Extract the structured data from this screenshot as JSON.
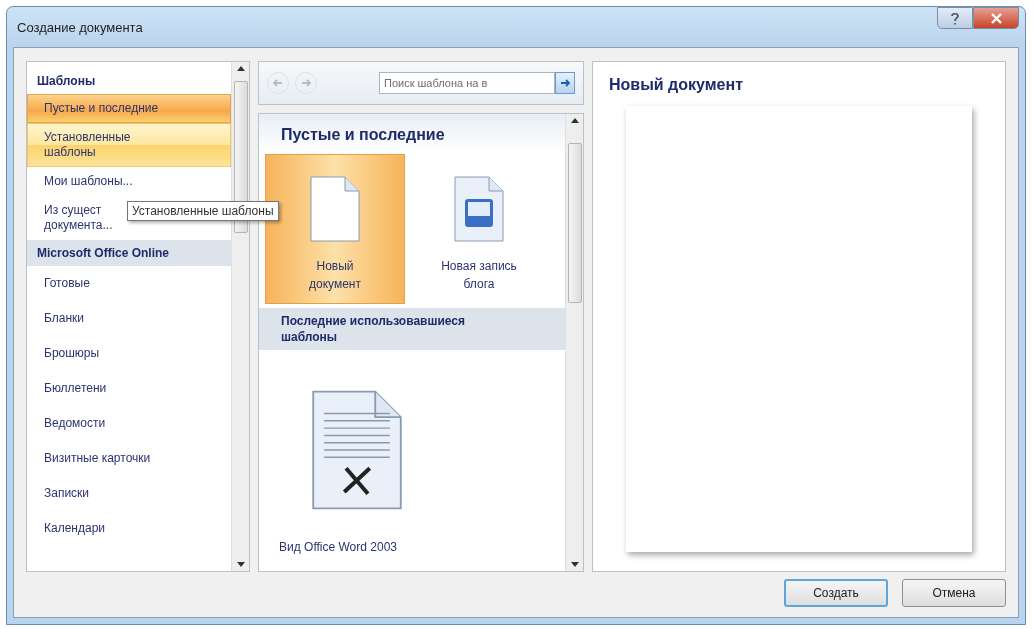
{
  "window": {
    "title": "Создание документа"
  },
  "sidebar": {
    "sections": [
      {
        "title": "Шаблоны",
        "kind": "plain",
        "items": [
          {
            "label": "Пустые и последние",
            "selected": true,
            "hovered": false
          },
          {
            "label": "Установленные\nшаблоны",
            "selected": false,
            "hovered": true
          },
          {
            "label": "Мои шаблоны...",
            "selected": false,
            "hovered": false
          },
          {
            "label": "Из сущест\nдокумента...",
            "selected": false,
            "hovered": false
          }
        ]
      },
      {
        "title": "Microsoft Office Online",
        "kind": "shaded",
        "items": [
          {
            "label": "Готовые",
            "selected": false,
            "hovered": false
          },
          {
            "label": "Бланки",
            "selected": false,
            "hovered": false
          },
          {
            "label": "Брошюры",
            "selected": false,
            "hovered": false
          },
          {
            "label": "Бюллетени",
            "selected": false,
            "hovered": false
          },
          {
            "label": "Ведомости",
            "selected": false,
            "hovered": false
          },
          {
            "label": "Визитные карточки",
            "selected": false,
            "hovered": false
          },
          {
            "label": "Записки",
            "selected": false,
            "hovered": false
          },
          {
            "label": "Календари",
            "selected": false,
            "hovered": false
          }
        ]
      }
    ]
  },
  "tooltip": "Установленные шаблоны",
  "toolbar": {
    "back_disabled": true,
    "forward_disabled": true,
    "search": {
      "placeholder": "Поиск шаблона на в"
    }
  },
  "gallery": {
    "title": "Пустые и последние",
    "tiles": [
      {
        "label": "Новый\nдокумент",
        "kind": "blank",
        "selected": true
      },
      {
        "label": "Новая запись\nблога",
        "kind": "blog",
        "selected": false
      }
    ],
    "recent_title": "Последние использовавшиеся шаблоны",
    "recent": [
      {
        "label": "Вид Office Word 2003",
        "kind": "classic"
      }
    ]
  },
  "preview": {
    "title": "Новый документ"
  },
  "buttons": [
    {
      "label": "Создать",
      "default": true
    },
    {
      "label": "Отмена",
      "default": false
    }
  ]
}
